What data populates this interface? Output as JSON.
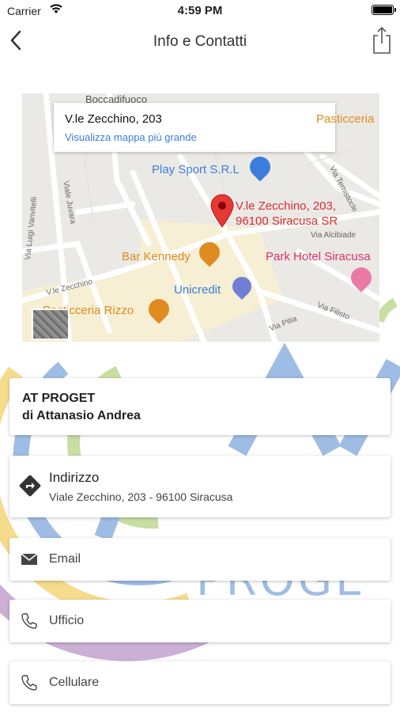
{
  "status_bar": {
    "carrier": "Carrier",
    "time": "4:59 PM"
  },
  "nav": {
    "title": "Info e Contatti",
    "back_icon": "chevron-left-icon",
    "share_icon": "share-icon"
  },
  "map": {
    "card_address": "V.le Zecchino, 203",
    "card_link": "Visualizza mappa più grande",
    "pin_label_line1": "V.le Zecchino, 203,",
    "pin_label_line2": "96100 Siracusa SR",
    "pois": {
      "pasticceria_top": "Pasticceria",
      "play_sport": "Play Sport S.R.L",
      "bar_kennedy": "Bar Kennedy",
      "park_hotel": "Park Hotel Siracusa",
      "unicredit": "Unicredit",
      "pasticceria_rizzo": "Pasticceria Rizzo"
    },
    "streets": {
      "boccadifuoco": "Boccadifuoco",
      "juvara": "Viale Juvara",
      "vanvitelli": "Via Luigi Vanvitelli",
      "zecchino": "V.le Zecchino",
      "alcibiade": "Via Alcibiade",
      "pitia": "Via Pitia",
      "filisto": "Via Filisto",
      "temistocle": "Via Temistocle"
    },
    "colors": {
      "poi_orange": "#e08b1f",
      "poi_blue": "#3b7ddd",
      "poi_pink": "#d6336c",
      "pin_red": "#e53935"
    }
  },
  "company": {
    "name": "AT PROGET",
    "owner": "di Attanasio Andrea"
  },
  "contacts": {
    "address_label": "Indirizzo",
    "address_value": "Viale Zecchino, 203 - 96100 Siracusa",
    "email_label": "Email",
    "office_label": "Ufficio",
    "mobile_label": "Cellulare"
  },
  "background": {
    "logo_text": "PROGE"
  }
}
